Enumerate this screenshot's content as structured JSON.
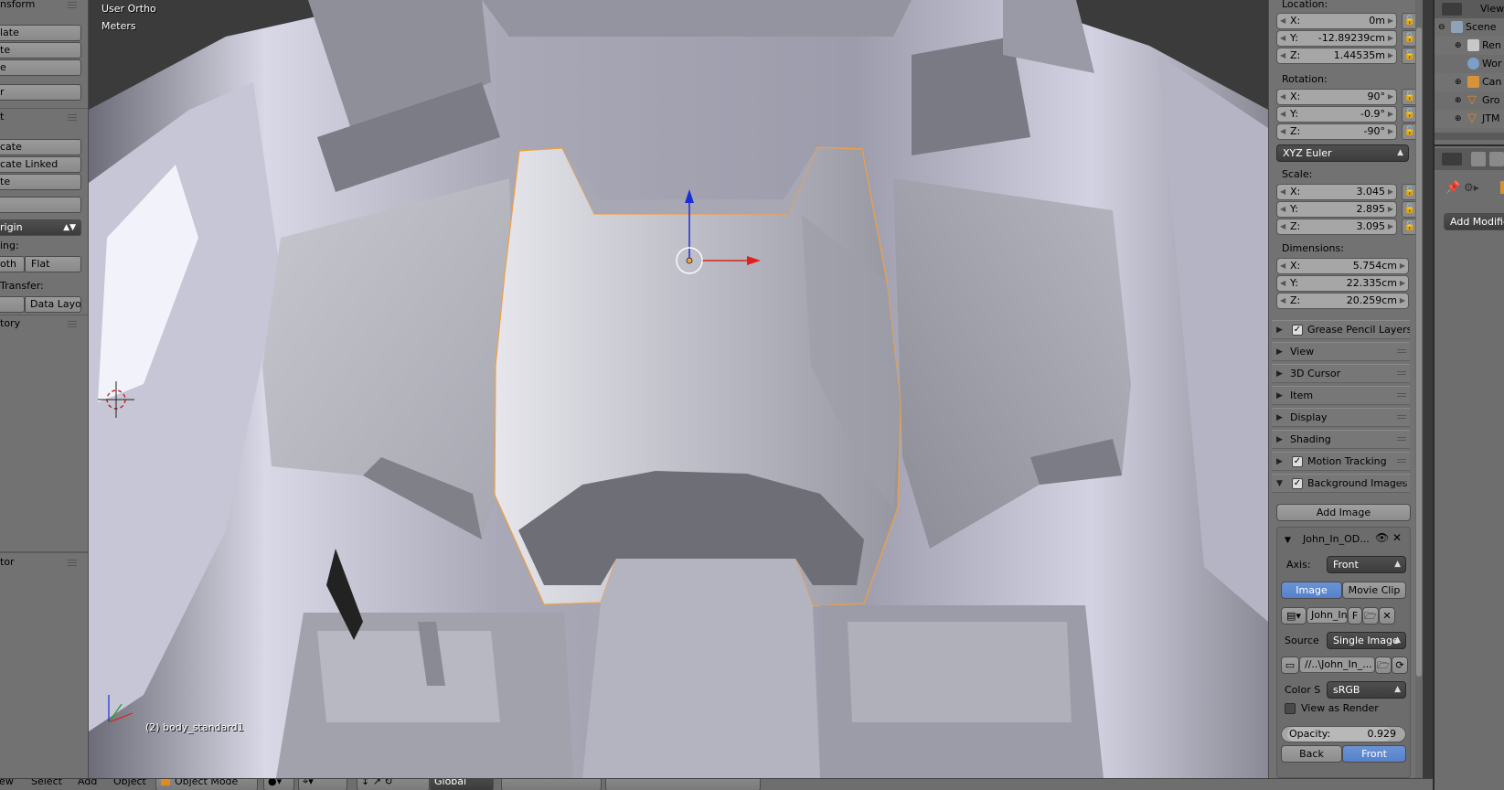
{
  "toolshelf": {
    "transform_header": "nsform",
    "buttons1": [
      "late",
      "te",
      "e"
    ],
    "button_r": "r",
    "edit_header": "t",
    "dup_buttons": [
      "cate",
      "cate Linked",
      "te"
    ],
    "blank_button": "",
    "set_origin": "rigin",
    "shading_label": "ing:",
    "smooth": "oth",
    "flat": "Flat",
    "transfer_label": "Transfer:",
    "data_layo": "Data Layo",
    "history_header": "tory",
    "operator_header": "tor"
  },
  "viewport": {
    "view_name": "User Ortho",
    "units": "Meters",
    "object_info": "(2) body_standard1"
  },
  "npanel": {
    "location_label": "Location:",
    "location": [
      {
        "axis": "X:",
        "value": "0m"
      },
      {
        "axis": "Y:",
        "value": "-12.89239cm"
      },
      {
        "axis": "Z:",
        "value": "1.44535m"
      }
    ],
    "rotation_label": "Rotation:",
    "rotation": [
      {
        "axis": "X:",
        "value": "90°"
      },
      {
        "axis": "Y:",
        "value": "-0.9°"
      },
      {
        "axis": "Z:",
        "value": "-90°"
      }
    ],
    "rotation_mode": "XYZ Euler",
    "scale_label": "Scale:",
    "scale": [
      {
        "axis": "X:",
        "value": "3.045"
      },
      {
        "axis": "Y:",
        "value": "2.895"
      },
      {
        "axis": "Z:",
        "value": "3.095"
      }
    ],
    "dimensions_label": "Dimensions:",
    "dimensions": [
      {
        "axis": "X:",
        "value": "5.754cm"
      },
      {
        "axis": "Y:",
        "value": "22.335cm"
      },
      {
        "axis": "Z:",
        "value": "20.259cm"
      }
    ],
    "sections": [
      {
        "label": "Grease Pencil Layers",
        "checkbox": true,
        "open": false
      },
      {
        "label": "View",
        "checkbox": false,
        "open": false
      },
      {
        "label": "3D Cursor",
        "checkbox": false,
        "open": false
      },
      {
        "label": "Item",
        "checkbox": false,
        "open": false
      },
      {
        "label": "Display",
        "checkbox": false,
        "open": false
      },
      {
        "label": "Shading",
        "checkbox": false,
        "open": false
      },
      {
        "label": "Motion Tracking",
        "checkbox": true,
        "open": false
      },
      {
        "label": "Background Images",
        "checkbox": true,
        "open": true
      }
    ],
    "background": {
      "add_image": "Add Image",
      "image_name": "John_In_OD...",
      "axis_label": "Axis:",
      "axis_value": "Front",
      "tab_image": "Image",
      "tab_movie": "Movie Clip",
      "image_field": "John_In",
      "image_f": "F",
      "source_label": "Source",
      "source_value": "Single Image",
      "filepath": "//..\\John_In_...",
      "color_label": "Color S",
      "color_value": "sRGB",
      "view_as_render": "View as Render",
      "opacity_label": "Opacity:",
      "opacity_value": "0.929",
      "opacity": 0.929,
      "back": "Back",
      "front": "Front"
    }
  },
  "outliner": {
    "view_label": "View",
    "rows": [
      {
        "label": "Scene",
        "icon": "scene-icon"
      },
      {
        "label": "Ren",
        "icon": "render-layers-icon"
      },
      {
        "label": "Wor",
        "icon": "world-icon"
      },
      {
        "label": "Can",
        "icon": "camera-icon"
      },
      {
        "label": "Gro",
        "icon": "mesh-icon"
      },
      {
        "label": "JTM",
        "icon": "mesh-icon"
      }
    ]
  },
  "properties": {
    "add_modifier": "Add Modifier"
  },
  "header": {
    "view": "iew",
    "select": "Select",
    "add": "Add",
    "object": "Object",
    "mode": "Object Mode",
    "orientation": "Global"
  },
  "colors": {
    "selection_outline": "#f0a040",
    "axis_x": "#e0201c",
    "axis_z": "#1a2ed8",
    "active_button": "#5680c9"
  }
}
